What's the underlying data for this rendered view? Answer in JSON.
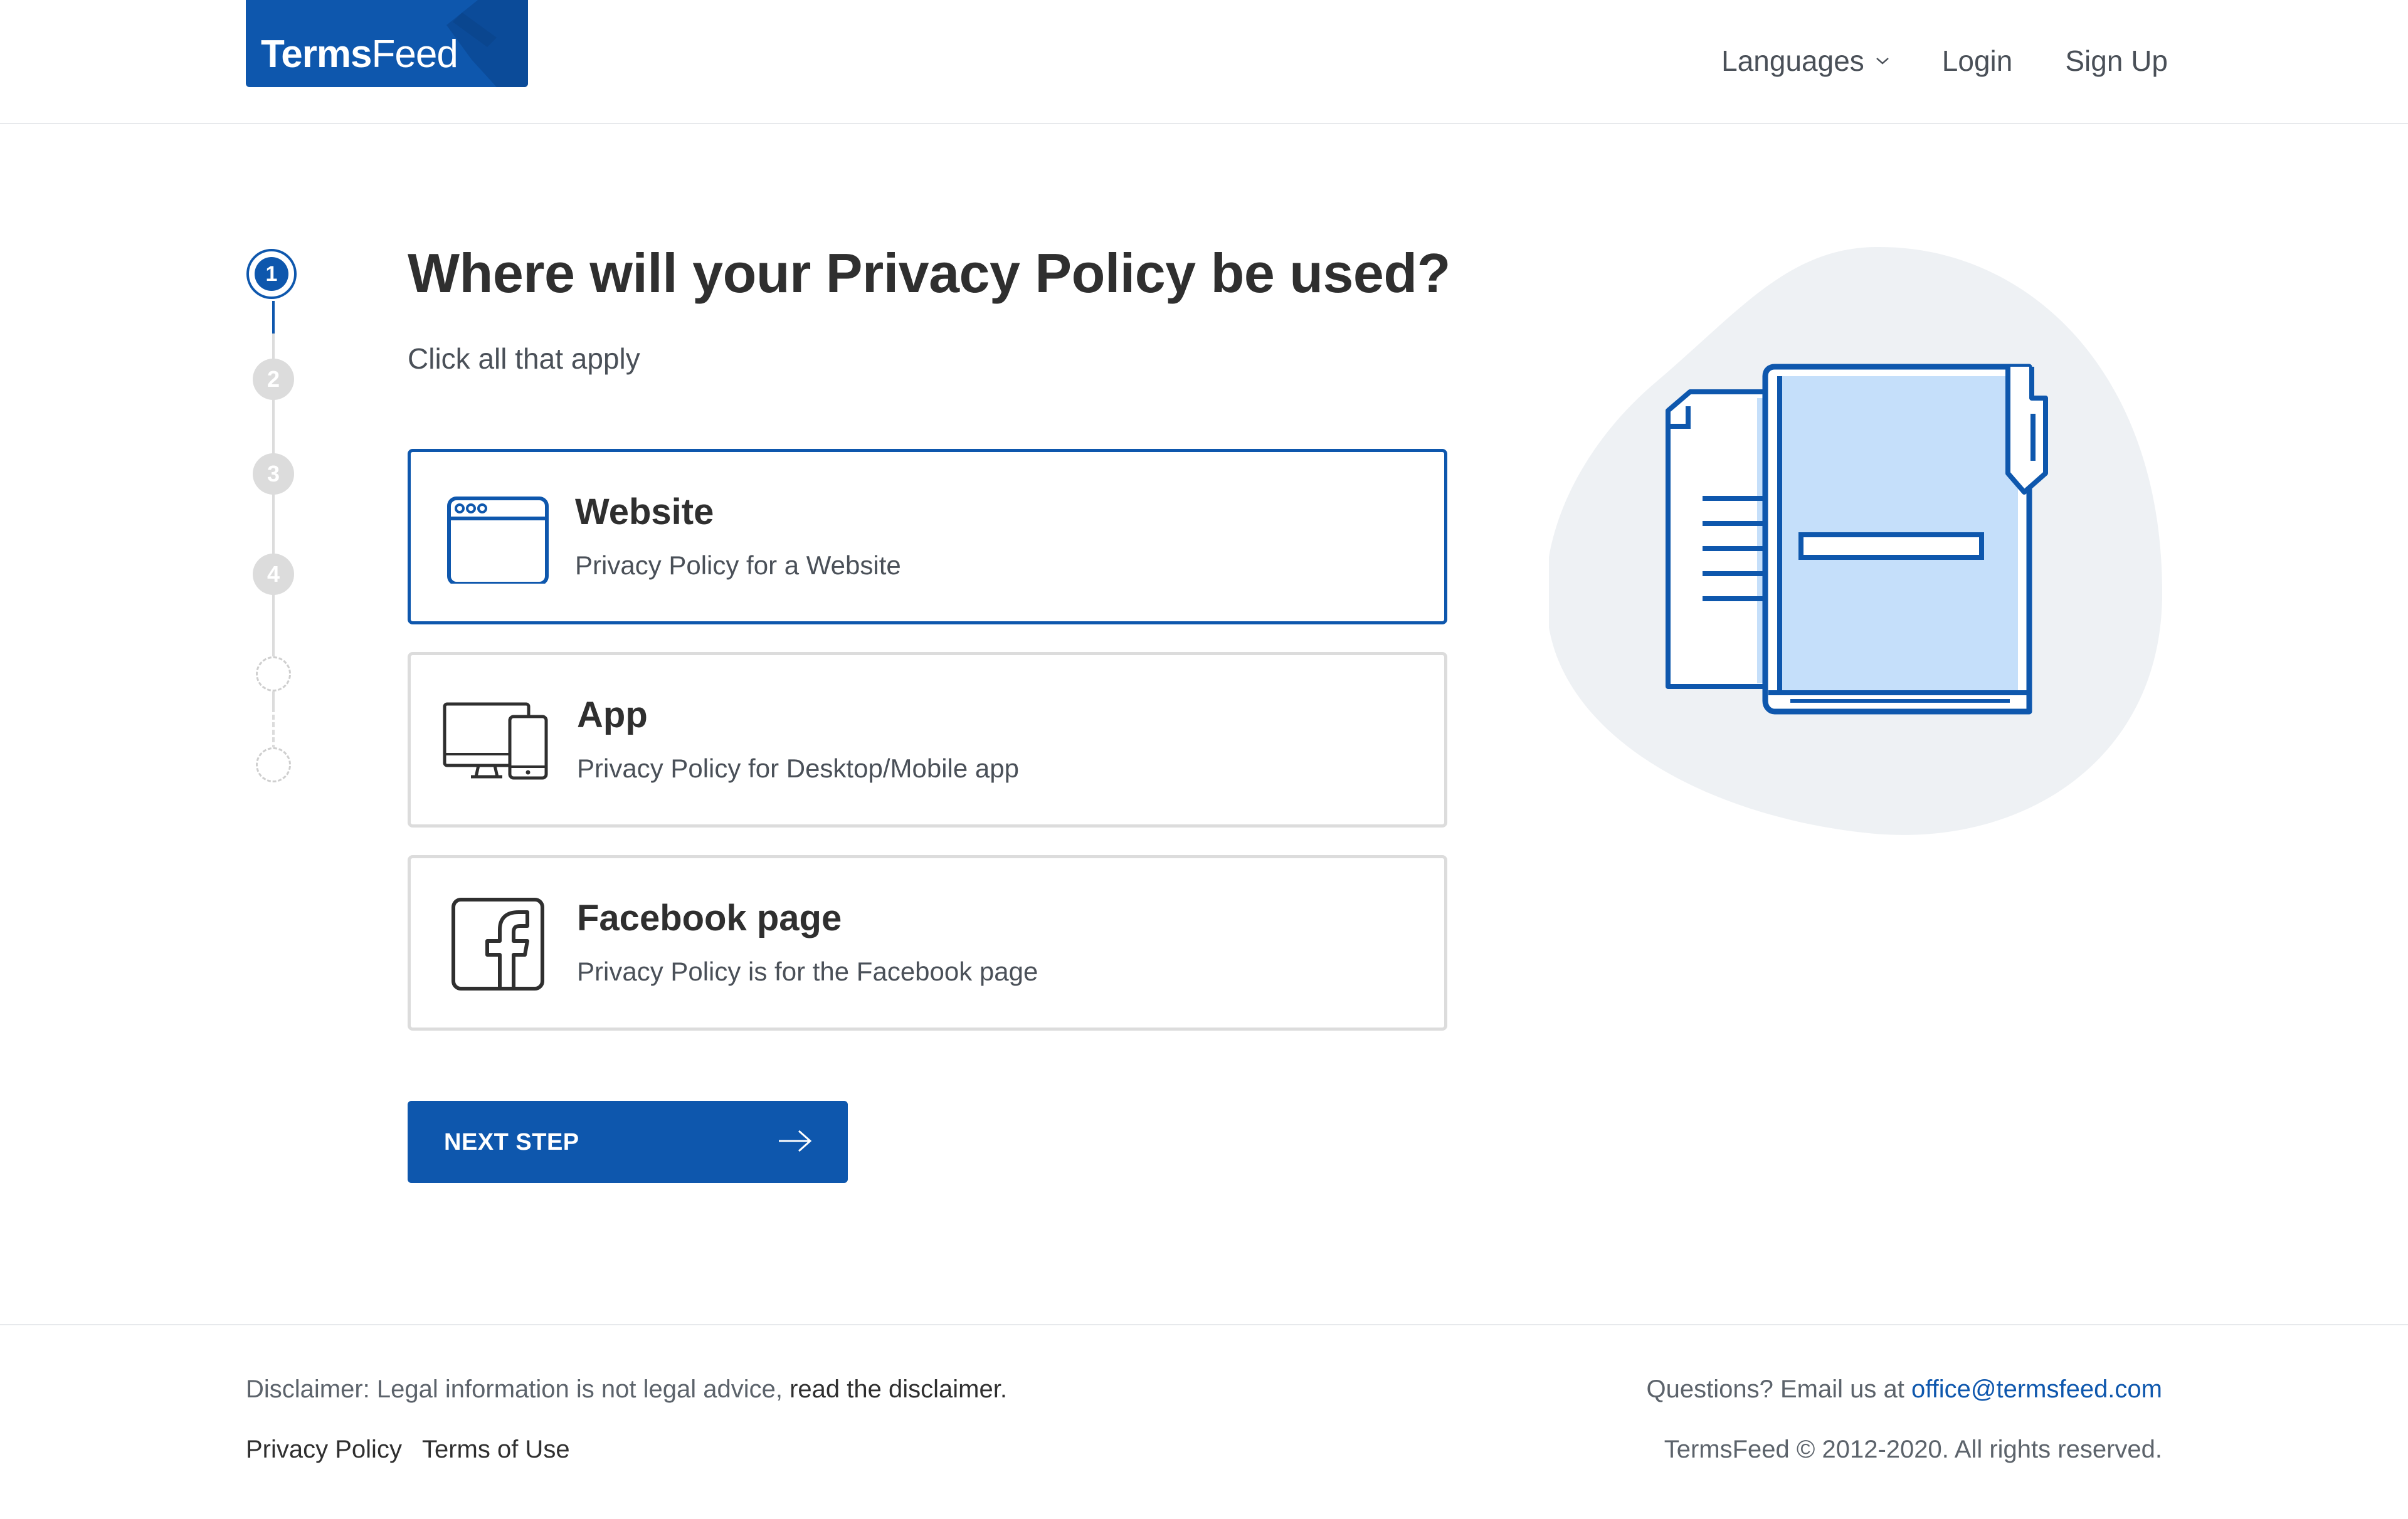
{
  "header": {
    "logo_bold": "Terms",
    "logo_light": "Feed",
    "nav": {
      "languages": "Languages",
      "login": "Login",
      "signup": "Sign Up"
    }
  },
  "stepper": {
    "steps": [
      "1",
      "2",
      "3",
      "4"
    ],
    "active_step": 1
  },
  "main": {
    "title": "Where will your Privacy Policy be used?",
    "subtitle": "Click all that apply",
    "options": [
      {
        "title": "Website",
        "desc": "Privacy Policy for a Website",
        "icon": "browser-window-icon",
        "selected": true
      },
      {
        "title": "App",
        "desc": "Privacy Policy for Desktop/Mobile app",
        "icon": "devices-icon",
        "selected": false
      },
      {
        "title": "Facebook page",
        "desc": "Privacy Policy is for the Facebook page",
        "icon": "facebook-icon",
        "selected": false
      }
    ],
    "next_button": "NEXT STEP"
  },
  "footer": {
    "disclaimer_prefix": "Disclaimer: Legal information is not legal advice,",
    "disclaimer_link": "read the disclaimer.",
    "privacy_policy": "Privacy Policy",
    "terms_of_use": "Terms of Use",
    "questions_prefix": "Questions? Email us at",
    "email": "office@termsfeed.com",
    "copyright": "TermsFeed © 2012-2020. All rights reserved."
  },
  "colors": {
    "brand_blue": "#0e57ad",
    "light_blue": "#c5dffa",
    "blob_gray": "#eef1f4",
    "border_gray": "#dcdcdc"
  }
}
